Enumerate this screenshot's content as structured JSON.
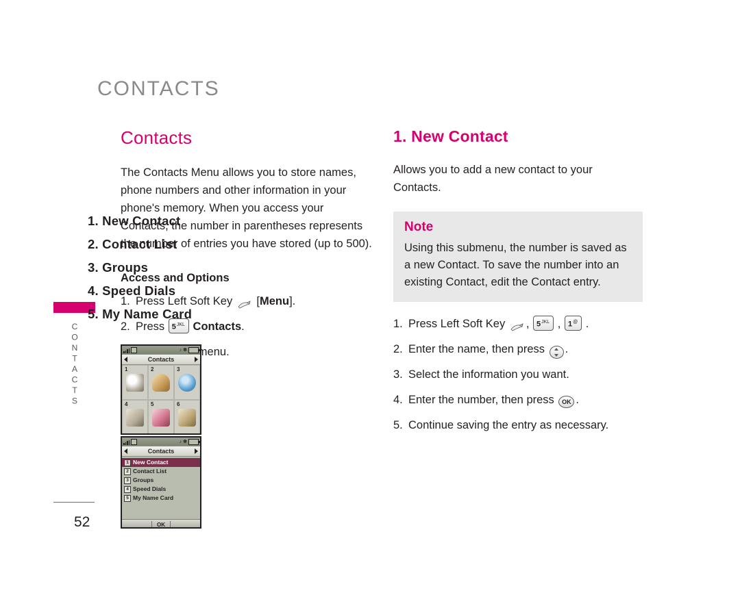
{
  "header": {
    "title": "CONTACTS"
  },
  "side": {
    "tab_label": "CONTACTS",
    "page_number": "52"
  },
  "left": {
    "title": "Contacts",
    "intro": "The Contacts Menu allows you to store names, phone numbers and other information in your phone's memory. When you access your Contacts, the number in parentheses represents the number of entries you have stored (up to 500).",
    "subtitle": "Access and Options",
    "steps": [
      {
        "num": "1.",
        "parts": [
          {
            "type": "text",
            "value": "Press Left Soft Key "
          },
          {
            "type": "softkey",
            "value": "soft-key-icon"
          },
          {
            "type": "text",
            "value": " ["
          },
          {
            "type": "bold",
            "value": "Menu"
          },
          {
            "type": "text",
            "value": "]."
          }
        ]
      },
      {
        "num": "2.",
        "parts": [
          {
            "type": "text",
            "value": "Press "
          },
          {
            "type": "key",
            "value": "5",
            "sup": "JKL"
          },
          {
            "type": "text",
            "value": " "
          },
          {
            "type": "bold",
            "value": "Contacts"
          },
          {
            "type": "text",
            "value": "."
          }
        ]
      },
      {
        "num": "3.",
        "parts": [
          {
            "type": "text",
            "value": "Select a submenu."
          }
        ]
      }
    ],
    "menu_items": [
      "1. New Contact",
      "2. Contact List",
      "3. Groups",
      "4. Speed Dials",
      "5. My Name Card"
    ]
  },
  "right": {
    "title": "1. New Contact",
    "intro": "Allows you to add a new contact to your Contacts.",
    "note": {
      "title": "Note",
      "text": "Using this submenu, the number is saved as a new Contact. To save the number into an existing Contact, edit the Contact entry."
    },
    "steps": [
      {
        "num": "1.",
        "parts": [
          {
            "type": "text",
            "value": "Press Left Soft Key "
          },
          {
            "type": "softkey",
            "value": "soft-key-icon"
          },
          {
            "type": "text",
            "value": ", "
          },
          {
            "type": "key",
            "value": "5",
            "sup": "JKL"
          },
          {
            "type": "text",
            "value": " , "
          },
          {
            "type": "key",
            "value": "1",
            "sup": "@"
          },
          {
            "type": "text",
            "value": " ."
          }
        ]
      },
      {
        "num": "2.",
        "parts": [
          {
            "type": "text",
            "value": "Enter the name, then press "
          },
          {
            "type": "navkey",
            "value": "navigation-key-icon"
          },
          {
            "type": "text",
            "value": "."
          }
        ]
      },
      {
        "num": "3.",
        "parts": [
          {
            "type": "text",
            "value": "Select the information you want."
          }
        ]
      },
      {
        "num": "4.",
        "parts": [
          {
            "type": "text",
            "value": "Enter the number, then press "
          },
          {
            "type": "okkey",
            "value": "OK"
          },
          {
            "type": "text",
            "value": "."
          }
        ]
      },
      {
        "num": "5.",
        "parts": [
          {
            "type": "text",
            "value": "Continue saving the entry as necessary."
          }
        ]
      }
    ]
  },
  "screenshots": {
    "grid": {
      "title": "Contacts",
      "cells": [
        {
          "n": "1",
          "art": "a1"
        },
        {
          "n": "2",
          "art": "a2"
        },
        {
          "n": "3",
          "art": "a3"
        },
        {
          "n": "4",
          "art": "a4"
        },
        {
          "n": "5",
          "art": "a5"
        },
        {
          "n": "6",
          "art": "a6"
        }
      ]
    },
    "list": {
      "title": "Contacts",
      "rows": [
        {
          "num": "1",
          "label": "New Contact",
          "selected": true
        },
        {
          "num": "2",
          "label": "Contact List",
          "selected": false
        },
        {
          "num": "3",
          "label": "Groups",
          "selected": false
        },
        {
          "num": "4",
          "label": "Speed Dials",
          "selected": false
        },
        {
          "num": "5",
          "label": "My Name Card",
          "selected": false
        }
      ],
      "softkey": "OK"
    }
  },
  "colors": {
    "accent": "#d6006e",
    "header_gray": "#8a8a8a",
    "note_bg": "#e8e8e8"
  }
}
